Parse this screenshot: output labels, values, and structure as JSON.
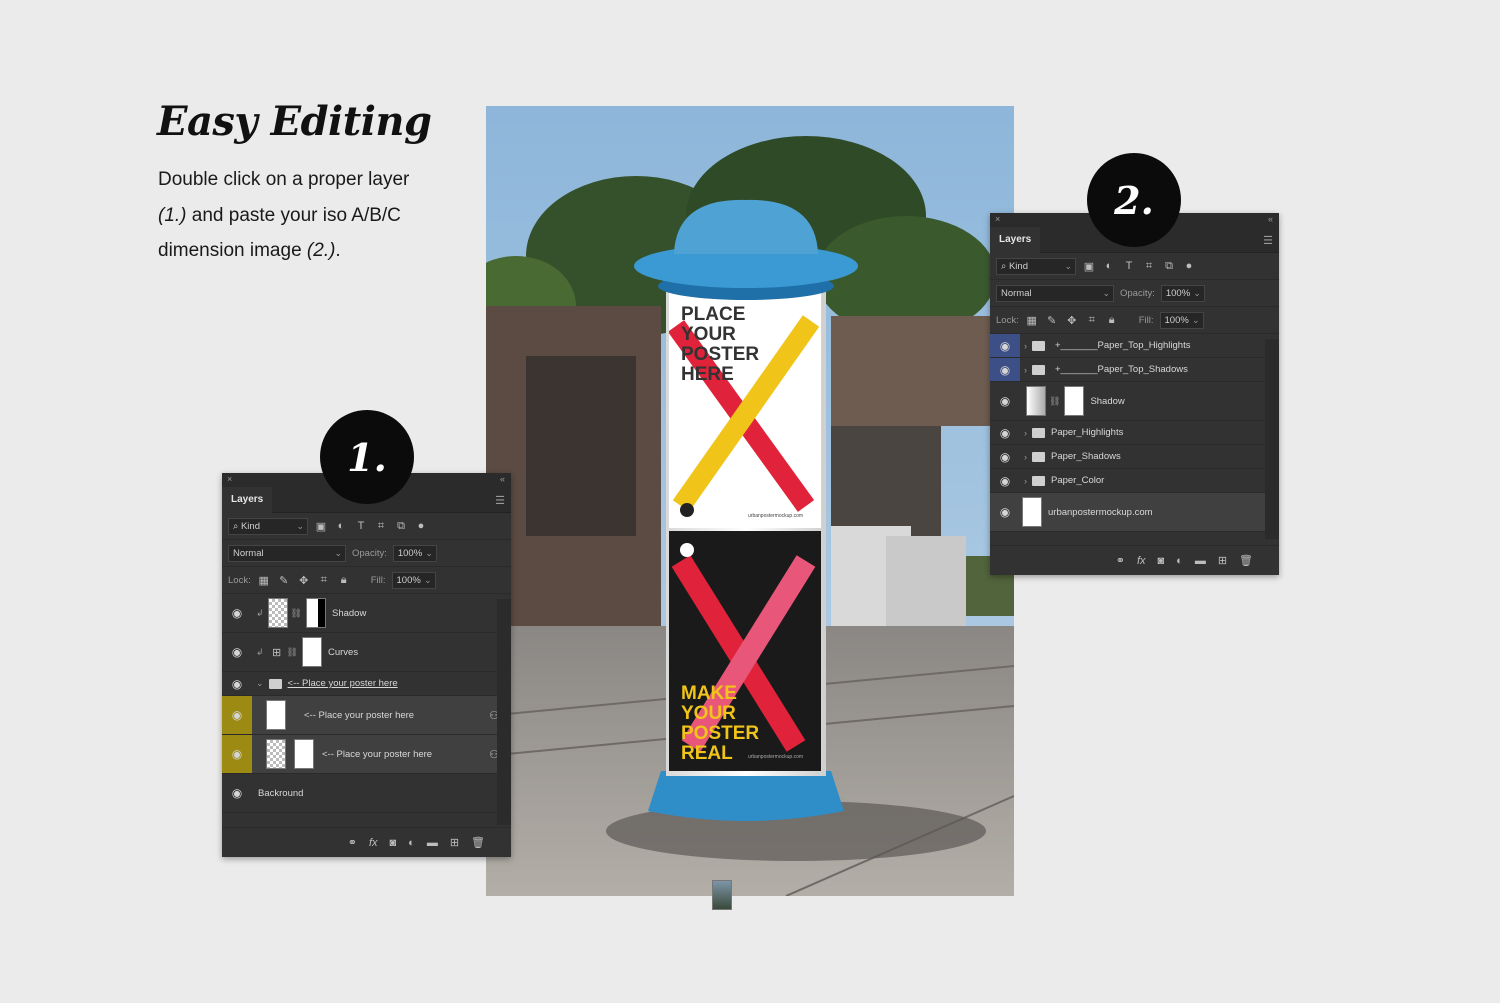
{
  "intro": {
    "heading": "Easy Editing",
    "line1": "Double click on a proper layer",
    "line2_ref": "(1.)",
    "line2_rest": " and paste your iso A/B/C",
    "line3_start": "dimension image ",
    "line3_ref": "(2.)",
    "line3_end": "."
  },
  "badges": {
    "one": "1.",
    "two": "2."
  },
  "poster": {
    "top_text": [
      "PLACE",
      "YOUR",
      "POSTER",
      "HERE"
    ],
    "bottom_text": [
      "MAKE",
      "YOUR",
      "POSTER",
      "REAL"
    ],
    "url": "urbanpostermockup.com"
  },
  "panel1": {
    "close": "×",
    "collapse": "«",
    "tab": "Layers",
    "menu": "☰",
    "kind": "Kind",
    "blend": "Normal",
    "opacity_label": "Opacity:",
    "opacity_value": "100%",
    "lock_label": "Lock:",
    "fill_label": "Fill:",
    "fill_value": "100%",
    "layers": [
      {
        "name": "Shadow"
      },
      {
        "name": "Curves"
      },
      {
        "name": "<-- Place your poster here"
      },
      {
        "name": "<-- Place your poster here"
      },
      {
        "name": "<-- Place your poster here"
      },
      {
        "name": "Backround"
      }
    ]
  },
  "panel2": {
    "close": "×",
    "collapse": "«",
    "tab": "Layers",
    "menu": "☰",
    "kind": "Kind",
    "blend": "Normal",
    "opacity_label": "Opacity:",
    "opacity_value": "100%",
    "lock_label": "Lock:",
    "fill_label": "Fill:",
    "fill_value": "100%",
    "layers": [
      {
        "name": "+_______Paper_Top_Highlights"
      },
      {
        "name": "+_______Paper_Top_Shadows"
      },
      {
        "name": "Shadow"
      },
      {
        "name": "Paper_Highlights"
      },
      {
        "name": "Paper_Shadows"
      },
      {
        "name": "Paper_Color"
      },
      {
        "name": "urbanpostermockup.com"
      }
    ]
  },
  "colors": {
    "background": "#ebebeb",
    "panel": "#323232",
    "selected_eye": "#9c8a12",
    "blue_eye": "#3d4f87",
    "column_blue": "#4fa3d4",
    "x_yellow": "#f0c419",
    "x_red": "#e0233a",
    "x_pink": "#e8577a"
  }
}
